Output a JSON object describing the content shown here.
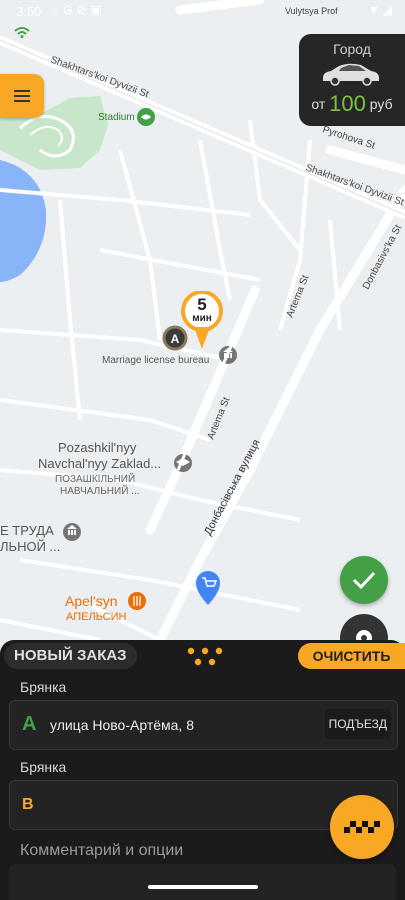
{
  "status_bar": {
    "time": "3:50",
    "icons": [
      "message-icon",
      "google-icon",
      "dnd-icon",
      "storage-icon"
    ],
    "right_icons": [
      "wifi-icon",
      "signal-icon"
    ]
  },
  "map": {
    "streets": [
      "Shakhtars'koi Dyvizii St",
      "Shakhtars'koi Dyvizii St",
      "Pyrohova St",
      "Vulytsya Prof",
      "Artema St",
      "Artema St",
      "Донбасівська вулиця",
      "Donbasivs'ka St"
    ],
    "pois": [
      {
        "name": "Stadium",
        "color": "#43a047"
      },
      {
        "name": "Marriage license bureau",
        "color": "#757575"
      },
      {
        "name": "Pozashkil'nyy Navchal'nyy Zaklad...",
        "name_line1": "Pozashkil'nyy",
        "name_line2": "Navchal'nyy Zaklad...",
        "sub_line1": "ПОЗАШКІЛЬНИЙ",
        "sub_line2": "НАВЧАЛЬНИЙ ...",
        "color": "#757575"
      },
      {
        "name_line1": "Е ТРУДА",
        "name_line2": "ЛЬНОЙ ...",
        "color": "#757575"
      },
      {
        "name": "Apel'syn",
        "sub": "АПЕЛЬСИН",
        "color": "#ef6c00"
      }
    ],
    "marker_a_letter": "A"
  },
  "pin": {
    "eta": "5",
    "unit": "мин"
  },
  "city_card": {
    "title": "Город",
    "price_prefix": "от",
    "price_value": "100",
    "currency": "руб"
  },
  "sheet": {
    "new_order_label": "НОВЫЙ ЗАКАЗ",
    "clear_label": "ОЧИСТИТЬ",
    "point_a": {
      "label": "Брянка",
      "letter": "A",
      "address": "улица Ново-Артёма, 8",
      "entrance_label": "ПОДЪЕЗД",
      "letter_color": "#43a047"
    },
    "point_b": {
      "label": "Брянка",
      "letter": "B",
      "address": "",
      "letter_color": "#f9a825"
    },
    "comment_label": "Комментарий и опции"
  },
  "colors": {
    "accent": "#f9a825",
    "ok": "#43a047",
    "sheet_bg": "#1b1b1b"
  }
}
